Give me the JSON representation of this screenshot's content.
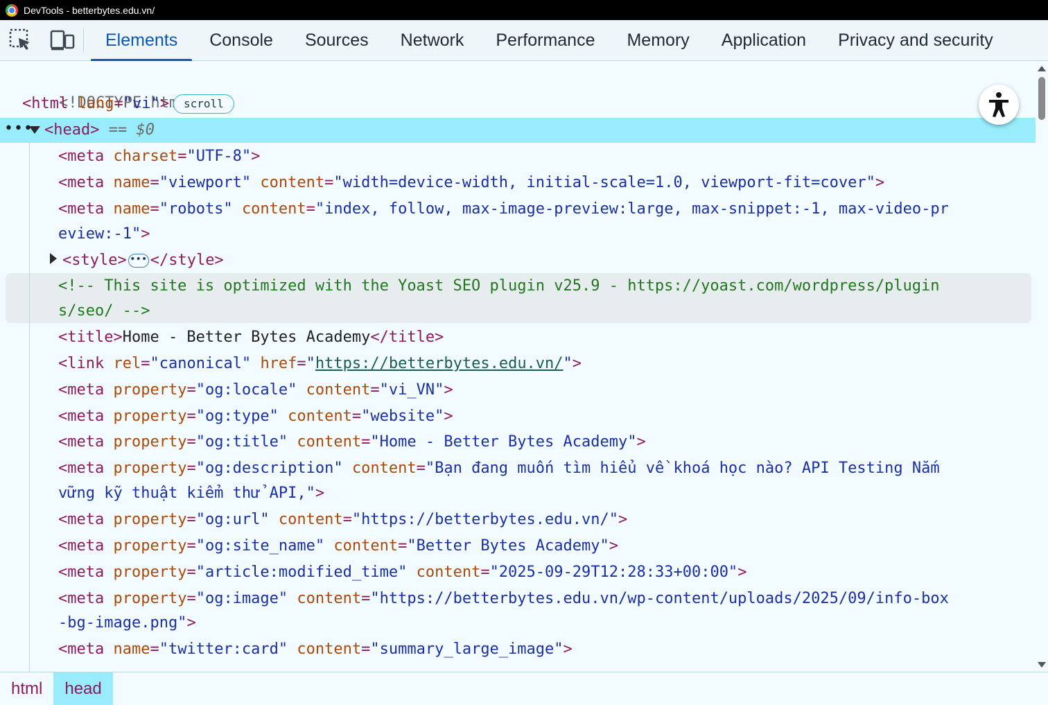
{
  "window": {
    "title": "DevTools - betterbytes.edu.vn/"
  },
  "toolbar": {
    "inspect_icon": "element-picker-icon",
    "device_icon": "device-toggle-icon",
    "tabs": [
      "Elements",
      "Console",
      "Sources",
      "Network",
      "Performance",
      "Memory",
      "Application",
      "Privacy and security"
    ],
    "active_tab": "Elements"
  },
  "dom": {
    "doctype": "<!DOCTYPE html>",
    "html_open": "<html",
    "html_lang_attr": "lang",
    "html_lang_val": "\"vi\"",
    "scroll_badge": "scroll",
    "head_open": "<head>",
    "head_eq": "== $0",
    "l1_attr": "charset",
    "l1_val": "\"UTF-8\"",
    "l2_name": "\"viewport\"",
    "l2_content": "\"width=device-width, initial-scale=1.0, viewport-fit=cover\"",
    "l3_name": "\"robots\"",
    "l3_content_a": "\"index, follow, max-image-preview:large, max-snippet:-1, max-video-pr",
    "l3_content_b": "eview:-1\"",
    "style_open": "<style>",
    "style_close": "</style>",
    "comment_a": "<!-- This site is optimized with the Yoast SEO plugin v25.9 - https://yoast.com/wordpress/plugin",
    "comment_b": "s/seo/ -->",
    "title_text": "Home - Better Bytes Academy",
    "canonical_href": "https://betterbytes.edu.vn/",
    "og_locale": "\"vi_VN\"",
    "og_type": "\"website\"",
    "og_title": "\"Home - Better Bytes Academy\"",
    "og_description_a": "\"Bạn đang muốn tìm hiểu về khoá học nào? API Testing Nắm",
    "og_description_b": "vững kỹ thuật kiểm thử API,\"",
    "og_url": "\"https://betterbytes.edu.vn/\"",
    "og_site_name": "\"Better Bytes Academy\"",
    "modified_time": "\"2025-09-29T12:28:33+00:00\"",
    "og_image_a": "\"https://betterbytes.edu.vn/wp-content/uploads/2025/09/info-box",
    "og_image_b": "-bg-image.png\"",
    "twitter_card": "\"summary_large_image\""
  },
  "accessibility_button": {
    "icon": "accessibility-icon"
  },
  "breadcrumbs": [
    "html",
    "head"
  ]
}
